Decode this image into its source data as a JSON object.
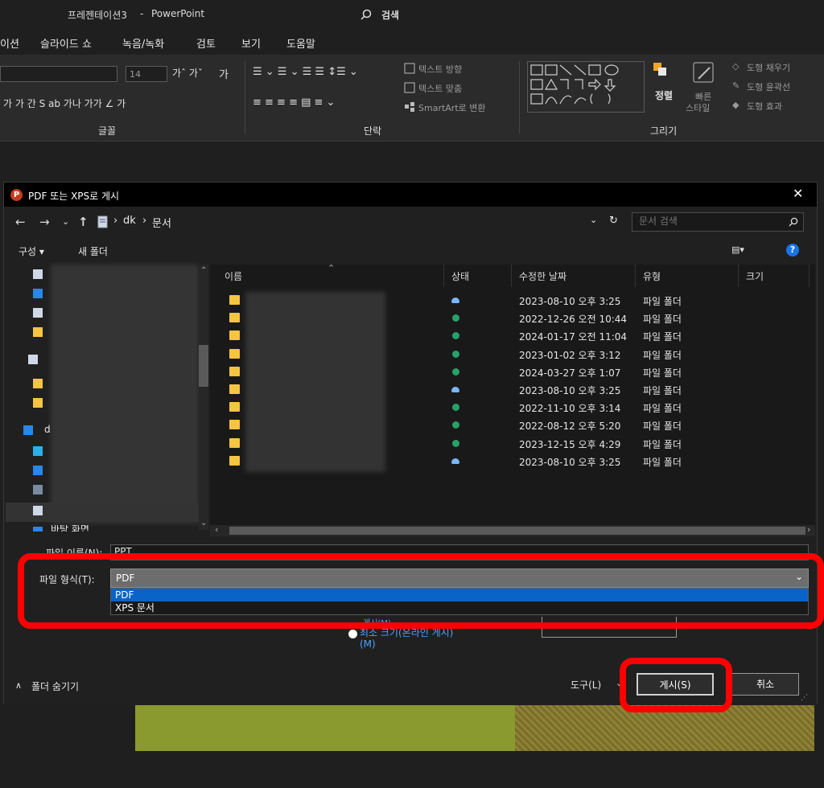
{
  "window": {
    "doc_title": "프레젠테이션3",
    "separator": "-",
    "app_name": "PowerPoint",
    "search_label": "검색"
  },
  "menu": [
    "이션",
    "슬라이드 쇼",
    "녹음/녹화",
    "검토",
    "보기",
    "도움말"
  ],
  "ribbon": {
    "font_size": "14",
    "groups": {
      "font": "글꼴",
      "paragraph": "단락",
      "drawing": "그리기"
    },
    "text_direction": "텍스트 방향",
    "align_text": "텍스트 맞춤",
    "smartart": "SmartArt로 변환",
    "arrange": "정렬",
    "quick_styles": [
      "빠른",
      "스타일"
    ],
    "shape_fill": "도형 채우기",
    "shape_outline": "도형 윤곽선",
    "shape_effects": "도형 효과"
  },
  "dialog": {
    "title": "PDF 또는 XPS로 게시",
    "close": "✕",
    "breadcrumb": [
      "dk",
      "문서"
    ],
    "search_placeholder": "문서 검색",
    "toolbar": {
      "organize": "구성 ▾",
      "new_folder": "새 폴더"
    },
    "nav_items": [
      "바탕 화면"
    ],
    "nav_partial": [
      "d"
    ],
    "columns": [
      "이름",
      "상태",
      "수정한 날짜",
      "유형",
      "크기"
    ],
    "rows": [
      {
        "status": "cloud",
        "date": "2023-08-10 오후 3:25",
        "type": "파일 폴더"
      },
      {
        "status": "sync",
        "date": "2022-12-26 오전 10:44",
        "type": "파일 폴더"
      },
      {
        "status": "sync",
        "date": "2024-01-17 오전 11:04",
        "type": "파일 폴더"
      },
      {
        "status": "sync",
        "date": "2023-01-02 오후 3:12",
        "type": "파일 폴더"
      },
      {
        "status": "sync",
        "date": "2024-03-27 오후 1:07",
        "type": "파일 폴더"
      },
      {
        "status": "cloud",
        "date": "2023-08-10 오후 3:25",
        "type": "파일 폴더"
      },
      {
        "status": "sync",
        "date": "2022-11-10 오후 3:14",
        "type": "파일 폴더"
      },
      {
        "status": "sync",
        "date": "2022-08-12 오후 5:20",
        "type": "파일 폴더"
      },
      {
        "status": "sync",
        "date": "2023-12-15 오후 4:29",
        "type": "파일 폴더"
      },
      {
        "status": "cloud",
        "date": "2023-08-10 오후 3:25",
        "type": "파일 폴더"
      }
    ],
    "filename_label": "파일 이름(N):",
    "filename_value": "PPT",
    "filetype_label": "파일 형식(T):",
    "filetype_value": "PDF",
    "filetype_options": [
      "PDF",
      "XPS 문서"
    ],
    "optimize_partial": "게시(M)",
    "min_size_option": "최소 크기(온라인 게시)(M)",
    "hide_folders": "폴더 숨기기",
    "tools": "도구(L)",
    "publish": "게시(S)",
    "cancel": "취소"
  },
  "colors": {
    "highlight": "#ff0000",
    "selection": "#0a64c8",
    "accent": "#1a73e8"
  }
}
